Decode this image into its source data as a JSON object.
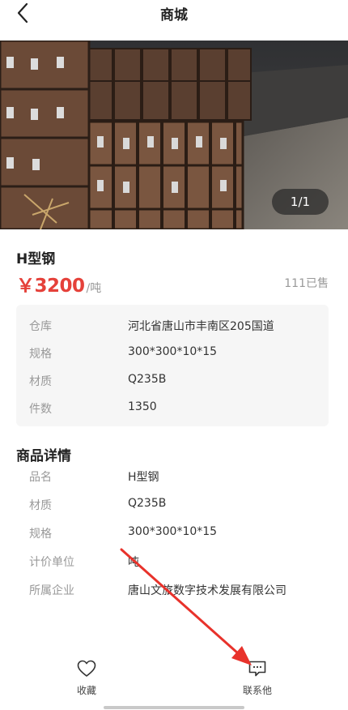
{
  "header": {
    "title": "商城"
  },
  "gallery": {
    "page_indicator": "1/1"
  },
  "product": {
    "name": "H型钢",
    "price": "￥3200",
    "price_unit": "/吨",
    "sold": "111已售"
  },
  "specs": [
    {
      "key": "仓库",
      "value": "河北省唐山市丰南区205国道"
    },
    {
      "key": "规格",
      "value": "300*300*10*15"
    },
    {
      "key": "材质",
      "value": "Q235B"
    },
    {
      "key": "件数",
      "value": "1350"
    }
  ],
  "details": {
    "title": "商品详情",
    "rows": [
      {
        "key": "品名",
        "value": "H型钢"
      },
      {
        "key": "材质",
        "value": "Q235B"
      },
      {
        "key": "规格",
        "value": "300*300*10*15"
      },
      {
        "key": "计价单位",
        "value": "吨"
      },
      {
        "key": "所属企业",
        "value": "唐山文旅数字技术发展有限公司"
      }
    ]
  },
  "bottom_bar": {
    "favorite_label": "收藏",
    "contact_label": "联系他"
  },
  "icons": {
    "back": "chevron-left-icon",
    "favorite": "heart-icon",
    "contact": "chat-bubble-icon"
  },
  "colors": {
    "price": "#e5413a",
    "annotation_arrow": "#e8322b"
  }
}
